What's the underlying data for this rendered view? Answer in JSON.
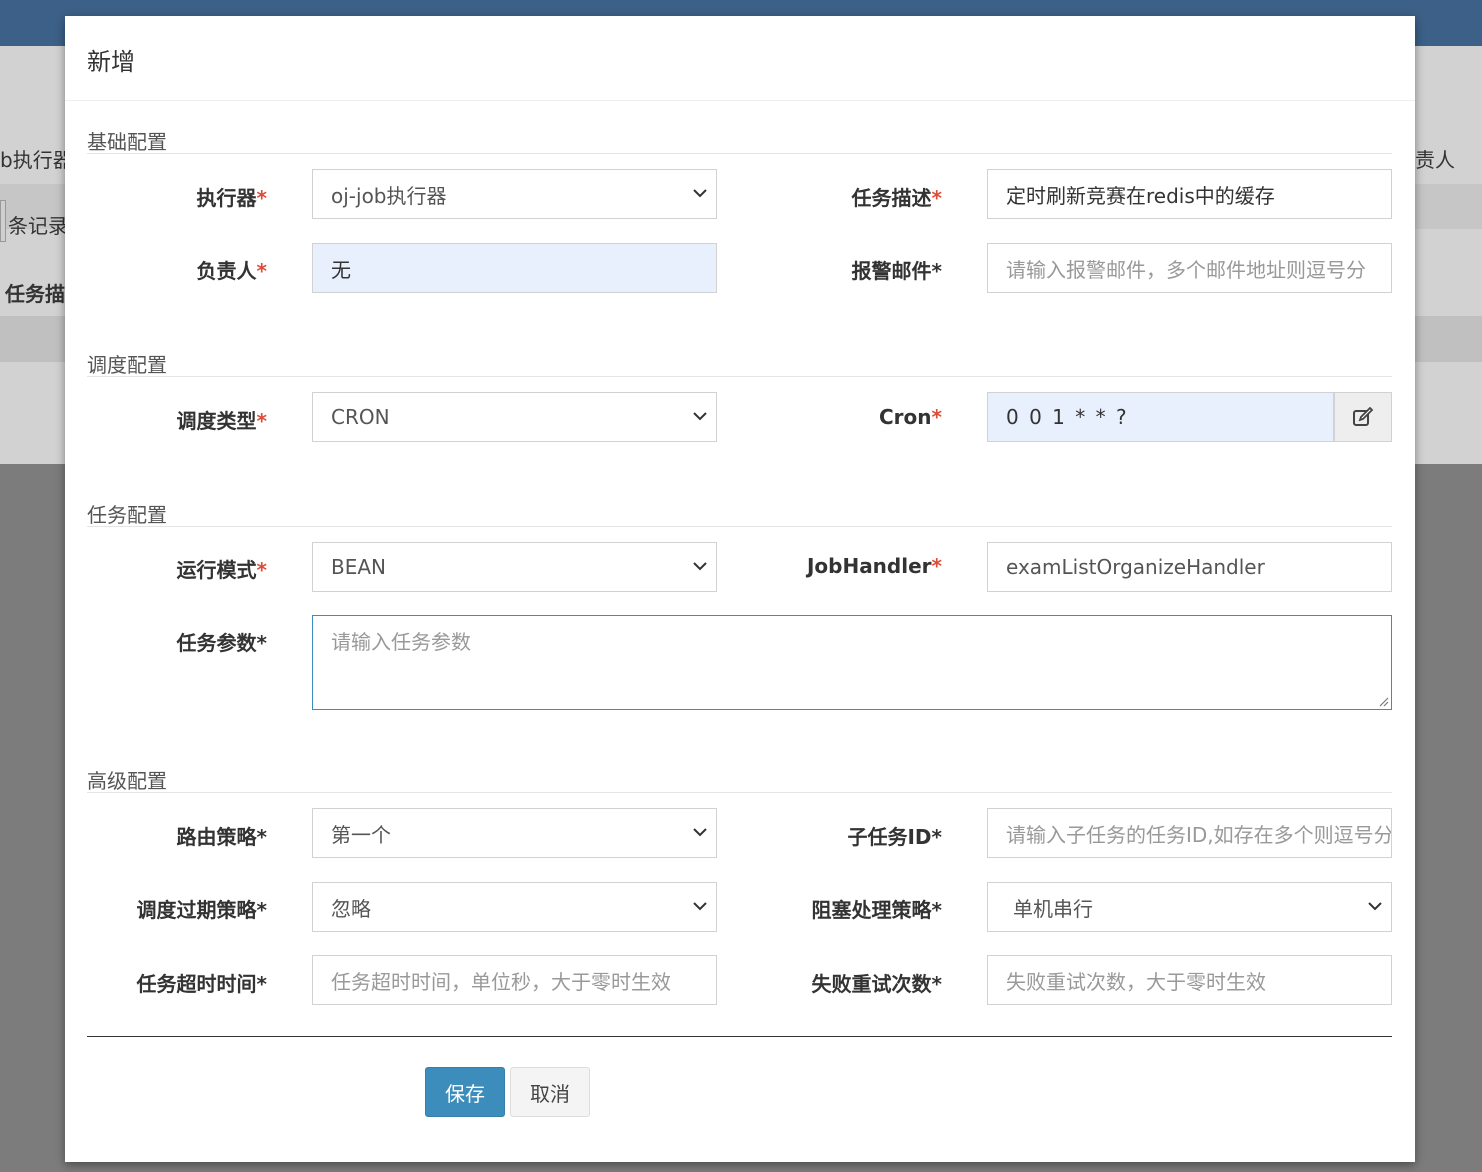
{
  "background": {
    "row1_left": "b执行器",
    "row2_left": "条记录",
    "row3_left": "任务描",
    "row1_right": "责人"
  },
  "modal": {
    "title": "新增",
    "sections": {
      "basic": "基础配置",
      "schedule": "调度配置",
      "task": "任务配置",
      "advanced": "高级配置"
    },
    "fields": {
      "executor": {
        "label": "执行器",
        "required_mark": "*",
        "value": "oj-job执行器"
      },
      "job_desc": {
        "label": "任务描述",
        "required_mark": "*",
        "value": "定时刷新竞赛在redis中的缓存"
      },
      "owner": {
        "label": "负责人",
        "required_mark": "*",
        "value": "无"
      },
      "alarm_email": {
        "label": "报警邮件*",
        "placeholder": "请输入报警邮件，多个邮件地址则逗号分"
      },
      "schedule_type": {
        "label": "调度类型",
        "required_mark": "*",
        "value": "CRON"
      },
      "cron": {
        "label": "Cron",
        "required_mark": "*",
        "value": "0 0 1 * * ?"
      },
      "glue_type": {
        "label": "运行模式",
        "required_mark": "*",
        "value": "BEAN"
      },
      "job_handler": {
        "label": "JobHandler",
        "required_mark": "*",
        "value": "examListOrganizeHandler"
      },
      "job_param": {
        "label": "任务参数*",
        "placeholder": "请输入任务参数"
      },
      "route_strategy": {
        "label": "路由策略*",
        "value": "第一个"
      },
      "child_job_id": {
        "label": "子任务ID*",
        "placeholder": "请输入子任务的任务ID,如存在多个则逗号分隔"
      },
      "misfire_strategy": {
        "label": "调度过期策略*",
        "value": "忽略"
      },
      "block_strategy": {
        "label": "阻塞处理策略*",
        "value": "单机串行"
      },
      "timeout": {
        "label": "任务超时时间*",
        "placeholder": "任务超时时间，单位秒，大于零时生效"
      },
      "fail_retry": {
        "label": "失败重试次数*",
        "placeholder": "失败重试次数，大于零时生效"
      }
    },
    "buttons": {
      "save": "保存",
      "cancel": "取消"
    }
  },
  "colors": {
    "header": "#3c6087",
    "primary": "#3c8dbc",
    "required": "#dd4b39",
    "autofill": "#e8f0fe"
  },
  "icons": {
    "select": "chevron-down-icon",
    "cron_edit": "edit-icon",
    "textarea": "resize-grip-icon"
  }
}
